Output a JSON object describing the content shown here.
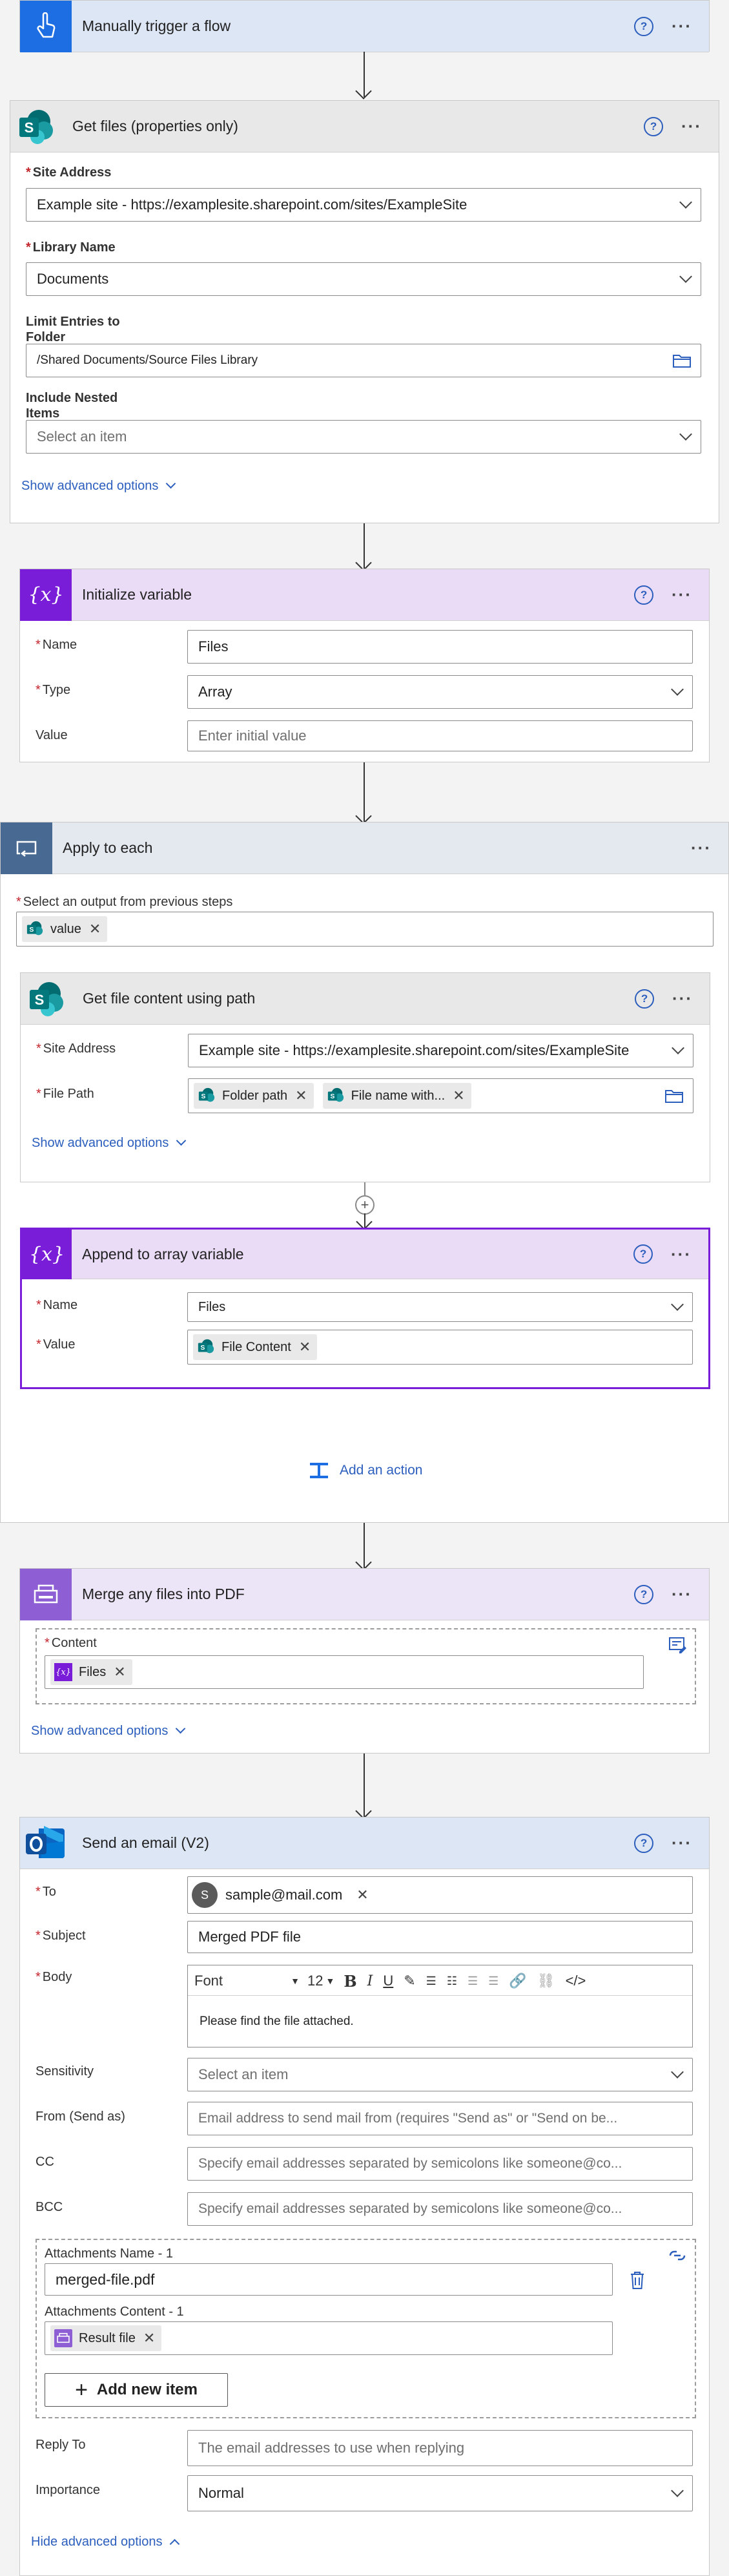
{
  "trigger": {
    "title": "Manually trigger a flow",
    "help": "?",
    "more": "···"
  },
  "get_files": {
    "title": "Get files (properties only)",
    "help": "?",
    "more": "···",
    "site_address_label": "Site Address",
    "site_address_value": "Example site - https://examplesite.sharepoint.com/sites/ExampleSite",
    "library_name_label": "Library Name",
    "library_name_value": "Documents",
    "limit_label_line1": "Limit Entries to",
    "limit_label_line2": "Folder",
    "limit_value": "/Shared Documents/Source Files Library",
    "nested_label_line1": "Include Nested",
    "nested_label_line2": "Items",
    "nested_placeholder": "Select an item",
    "advanced_link": "Show advanced options"
  },
  "init_variable": {
    "title": "Initialize variable",
    "help": "?",
    "more": "···",
    "icon_text": "{x}",
    "name_label": "Name",
    "name_value": "Files",
    "type_label": "Type",
    "type_value": "Array",
    "value_label": "Value",
    "value_placeholder": "Enter initial value"
  },
  "apply_each": {
    "title": "Apply to each",
    "more": "···",
    "select_label": "Select an output from previous steps",
    "token_value": "value",
    "add_action": "Add an action"
  },
  "get_content": {
    "title": "Get file content using path",
    "help": "?",
    "more": "···",
    "site_address_label": "Site Address",
    "site_address_value": "Example site - https://examplesite.sharepoint.com/sites/ExampleSite",
    "file_path_label": "File Path",
    "token_folder": "Folder path",
    "token_filename": "File name with...",
    "advanced_link": "Show advanced options"
  },
  "append_array": {
    "title": "Append to array variable",
    "help": "?",
    "more": "···",
    "icon_text": "{x}",
    "name_label": "Name",
    "name_value": "Files",
    "value_label": "Value",
    "token_value": "File Content"
  },
  "merge_pdf": {
    "title": "Merge any files into PDF",
    "help": "?",
    "more": "···",
    "content_label": "Content",
    "token_files": "Files",
    "advanced_link": "Show advanced options"
  },
  "send_email": {
    "title": "Send an email (V2)",
    "help": "?",
    "more": "···",
    "to_label": "To",
    "to_avatar": "S",
    "to_value": "sample@mail.com",
    "subject_label": "Subject",
    "subject_value": "Merged PDF file",
    "body_label": "Body",
    "font_name": "Font",
    "font_size": "12",
    "body_text": "Please find the file attached.",
    "sensitivity_label": "Sensitivity",
    "sensitivity_placeholder": "Select an item",
    "from_label": "From (Send as)",
    "from_placeholder": "Email address to send mail from (requires \"Send as\" or \"Send on be...",
    "cc_label": "CC",
    "cc_placeholder": "Specify email addresses separated by semicolons like someone@co...",
    "bcc_label": "BCC",
    "bcc_placeholder": "Specify email addresses separated by semicolons like someone@co...",
    "attach_name_label": "Attachments Name - 1",
    "attach_name_value": "merged-file.pdf",
    "attach_content_label": "Attachments Content - 1",
    "attach_token": "Result file",
    "add_new_item": "Add new item",
    "reply_to_label": "Reply To",
    "reply_to_placeholder": "The email addresses to use when replying",
    "importance_label": "Importance",
    "importance_value": "Normal",
    "advanced_link": "Hide advanced options"
  },
  "colors": {
    "accent_blue": "#2b5ebd",
    "variable_purple": "#7a1dd8",
    "required_red": "#c4262e"
  }
}
